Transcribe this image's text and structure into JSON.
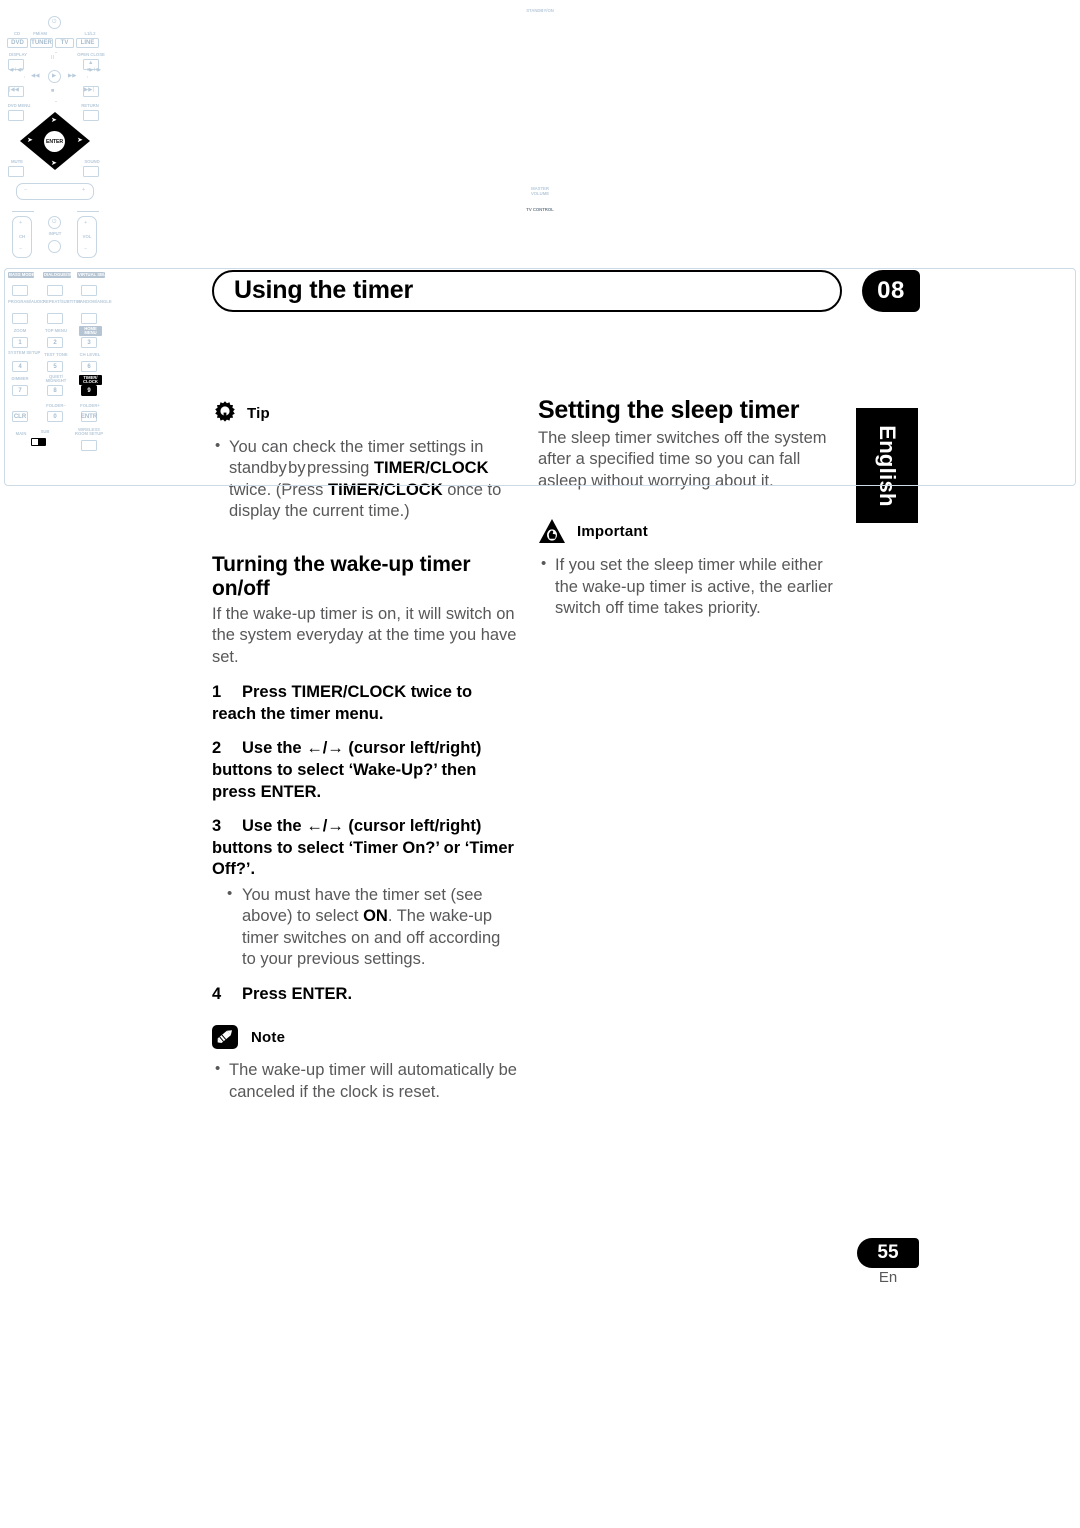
{
  "header": {
    "title": "Using the timer",
    "chapter": "08"
  },
  "language_tab": "English",
  "footer": {
    "page_number": "55",
    "language_code": "En"
  },
  "left_column": {
    "tip": {
      "icon": "tip-bulb-icon",
      "label": "Tip",
      "bullets": [
        "You can check the timer settings in standby by pressing TIMER/CLOCK twice. (Press TIMER/CLOCK once to display the current time.)"
      ]
    },
    "section": {
      "heading": "Turning the wake-up timer on/off",
      "intro": "If the wake-up timer is on, it will switch on the system everyday at the time you have set.",
      "steps": [
        {
          "number": "1",
          "text": "Press TIMER/CLOCK twice to reach the timer menu."
        },
        {
          "number": "2",
          "text_before": "Use the",
          "arrows": "←/→",
          "text_after": "(cursor left/right) buttons to select ‘Wake-Up?’ then press ENTER."
        },
        {
          "number": "3",
          "text_before": "Use the",
          "arrows": "←/→",
          "text_after": "(cursor left/right) buttons to select ‘Timer On?’ or ‘Timer Off?’.",
          "sub_bullets": [
            "You must have the timer set (see above) to select ON. The wake-up timer switches on and off according to your previous settings."
          ]
        },
        {
          "number": "4",
          "text": "Press ENTER."
        }
      ]
    },
    "note": {
      "icon": "pencil-note-icon",
      "label": "Note",
      "bullets": [
        "The wake-up timer will automatically be canceled if the clock is reset."
      ]
    }
  },
  "right_column": {
    "heading": "Setting the sleep timer",
    "intro": "The sleep timer switches off the system after a specified time so you can fall asleep without worrying about it.",
    "important": {
      "icon": "warning-triangle-icon",
      "label": "Important",
      "bullets": [
        "If you set the sleep timer while either the wake-up timer is active, the earlier switch off time takes priority."
      ]
    }
  },
  "remote_diagram": {
    "name": "remote-control-illustration",
    "highlighted_button": "TIMER/CLOCK",
    "top_section": {
      "standby_label": "STANDBY/ON",
      "source_row_top_labels": [
        "CD",
        "FM/AM",
        "",
        "L1/L2"
      ],
      "source_buttons": [
        "DVD",
        "TUNER",
        "TV",
        "LINE"
      ],
      "display_label": "DISPLAY",
      "open_close_label": "OPEN CLOSE"
    },
    "transport": {
      "pause": "⏸",
      "play": "▶",
      "rew": "◀◀",
      "ffwd": "▶▶",
      "stop": "■",
      "prev": "|◀◀",
      "next": "▶▶|",
      "slow_left": "◀I / ◀II",
      "slow_right": "II▶ / I▶"
    },
    "cursor_area": {
      "dvd_menu": "DVD MENU",
      "return": "RETURN",
      "enter": "ENTER",
      "mute": "MUTE",
      "sound": "SOUND"
    },
    "volume": {
      "label": "MASTER VOLUME",
      "minus": "−",
      "plus": "+"
    },
    "tv_control": {
      "label": "TV CONTROL",
      "ch": "CH",
      "input": "INPUT",
      "vol": "VOL"
    },
    "keypad": {
      "row_mode": [
        "BASS MODE/AUTO",
        "DIALOGUE/SURROUND",
        "VIRTUAL SB/ADVANCED"
      ],
      "row_program": [
        "PROGRAM/AUDIO",
        "REPEAT/SUBTITLE",
        "RANDOM/ANGLE"
      ],
      "row1_labels": [
        "ZOOM",
        "TOP MENU",
        "HOME MENU"
      ],
      "row1_keys": [
        "1",
        "2",
        "3"
      ],
      "row2_labels": [
        "SYSTEM SETUP",
        "TEST TONE",
        "CH LEVEL"
      ],
      "row2_keys": [
        "4",
        "5",
        "6"
      ],
      "row3_labels": [
        "DIMMER",
        "QUIET/MIDNIGHT",
        "TIMER/CLOCK"
      ],
      "row3_keys": [
        "7",
        "8",
        "9"
      ],
      "row4_labels": [
        "CLR",
        "FOLDER−",
        "FOLDER+"
      ],
      "row4_keys": [
        "CLR",
        "0",
        "ENTR"
      ],
      "bottom_left": "MAIN",
      "bottom_sub": "SUB",
      "bottom_right": "WIRELESS ROOM SETUP"
    }
  }
}
